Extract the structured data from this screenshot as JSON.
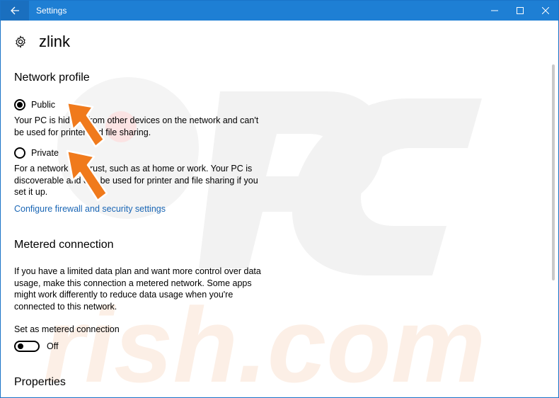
{
  "window": {
    "title": "Settings",
    "back_icon": "back-arrow-icon",
    "controls": [
      "minimize-icon",
      "maximize-icon",
      "close-icon"
    ]
  },
  "page": {
    "title": "zlink",
    "icon": "gear-icon"
  },
  "network_profile": {
    "heading": "Network profile",
    "options": [
      {
        "label": "Public",
        "checked": true,
        "description": "Your PC is hidden from other devices on the network and can't be used for printer and file sharing."
      },
      {
        "label": "Private",
        "checked": false,
        "description": "For a network you trust, such as at home or work. Your PC is discoverable and can be used for printer and file sharing if you set it up."
      }
    ],
    "firewall_link": "Configure firewall and security settings"
  },
  "metered": {
    "heading": "Metered connection",
    "description": "If you have a limited data plan and want more control over data usage, make this connection a metered network. Some apps might work differently to reduce data usage when you're connected to this network.",
    "toggle_label": "Set as metered connection",
    "toggle_state": "Off"
  },
  "properties": {
    "heading": "Properties"
  },
  "colors": {
    "titlebar": "#1e7fd4",
    "link": "#1a66b5",
    "annotation_arrow": "#f07a1c"
  }
}
